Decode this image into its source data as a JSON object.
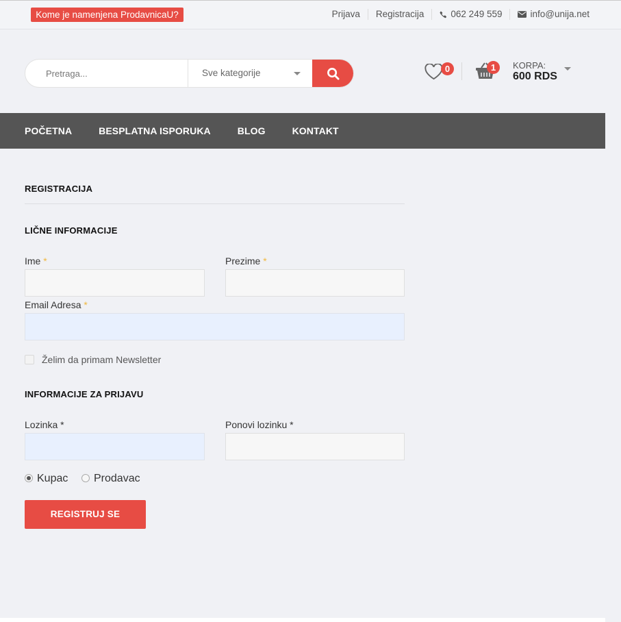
{
  "topbar": {
    "promo": "Kome je namenjena ProdavnicaU?",
    "links": {
      "login": "Prijava",
      "register": "Registracija",
      "phone": "062 249 559",
      "email": "info@unija.net"
    }
  },
  "header": {
    "search_placeholder": "Pretraga...",
    "category": "Sve kategorije",
    "wishlist_count": "0",
    "cart_count": "1",
    "cart_label": "KORPA:",
    "cart_total": "600 RDS"
  },
  "nav": {
    "items": [
      "POČETNA",
      "BESPLATNA ISPORUKA",
      "BLOG",
      "KONTAKT"
    ]
  },
  "form": {
    "title": "REGISTRACIJA",
    "personal_section": "LIČNE INFORMACIJE",
    "first_name_label": "Ime",
    "last_name_label": "Prezime",
    "email_label": "Email Adresa",
    "required_mark": "*",
    "newsletter_label": "Želim da primam Newsletter",
    "login_section": "INFORMACIJE ZA PRIJAVU",
    "password_label": "Lozinka *",
    "password_repeat_label": "Ponovi lozinku *",
    "role_buyer": "Kupac",
    "role_seller": "Prodavac",
    "role_selected": "Kupac",
    "submit_label": "REGISTRUJ SE"
  },
  "colors": {
    "accent": "#e74c44",
    "nav_bg": "#555555",
    "page_bg": "#f0f1f5",
    "required": "#f0b840"
  }
}
